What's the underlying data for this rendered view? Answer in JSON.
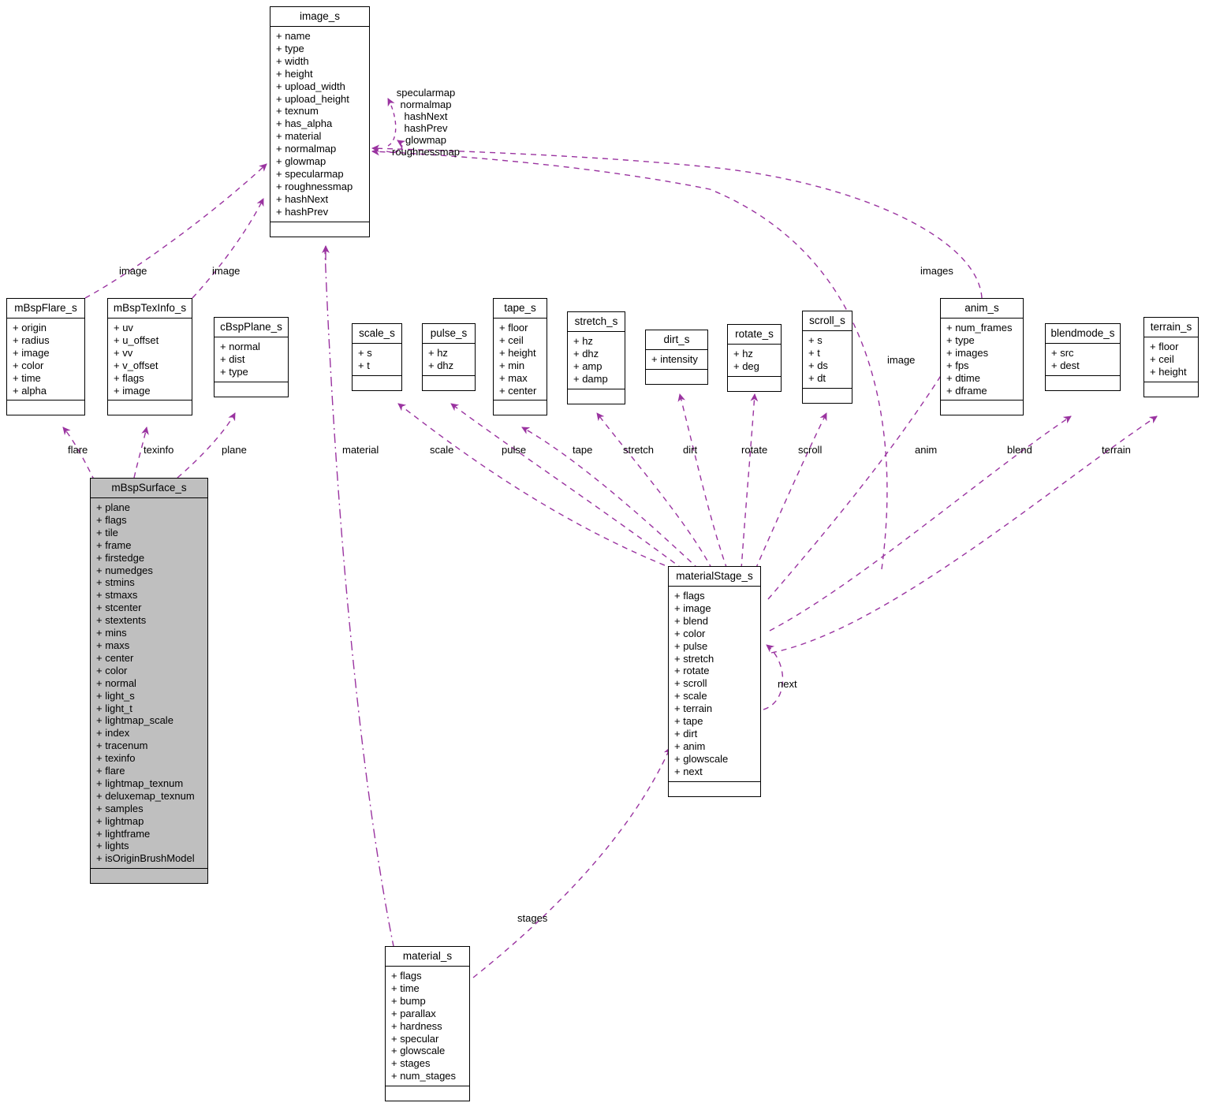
{
  "diagram": {
    "type": "uml-collaboration-diagram",
    "edge_color": "#9a33a0",
    "highlight_fill": "#bfbfbf",
    "border_color": "#000000"
  },
  "nodes": {
    "image_s": {
      "title": "image_s",
      "fields": [
        "+ name",
        "+ type",
        "+ width",
        "+ height",
        "+ upload_width",
        "+ upload_height",
        "+ texnum",
        "+ has_alpha",
        "+ material",
        "+ normalmap",
        "+ glowmap",
        "+ specularmap",
        "+ roughnessmap",
        "+ hashNext",
        "+ hashPrev"
      ],
      "methods": []
    },
    "mBspFlare_s": {
      "title": "mBspFlare_s",
      "fields": [
        "+ origin",
        "+ radius",
        "+ image",
        "+ color",
        "+ time",
        "+ alpha"
      ],
      "methods": []
    },
    "mBspTexInfo_s": {
      "title": "mBspTexInfo_s",
      "fields": [
        "+ uv",
        "+ u_offset",
        "+ vv",
        "+ v_offset",
        "+ flags",
        "+ image"
      ],
      "methods": []
    },
    "cBspPlane_s": {
      "title": "cBspPlane_s",
      "fields": [
        "+ normal",
        "+ dist",
        "+ type"
      ],
      "methods": []
    },
    "scale_s": {
      "title": "scale_s",
      "fields": [
        "+ s",
        "+ t"
      ],
      "methods": []
    },
    "pulse_s": {
      "title": "pulse_s",
      "fields": [
        "+ hz",
        "+ dhz"
      ],
      "methods": []
    },
    "tape_s": {
      "title": "tape_s",
      "fields": [
        "+ floor",
        "+ ceil",
        "+ height",
        "+ min",
        "+ max",
        "+ center"
      ],
      "methods": []
    },
    "stretch_s": {
      "title": "stretch_s",
      "fields": [
        "+ hz",
        "+ dhz",
        "+ amp",
        "+ damp"
      ],
      "methods": []
    },
    "dirt_s": {
      "title": "dirt_s",
      "fields": [
        "+ intensity"
      ],
      "methods": []
    },
    "rotate_s": {
      "title": "rotate_s",
      "fields": [
        "+ hz",
        "+ deg"
      ],
      "methods": []
    },
    "scroll_s": {
      "title": "scroll_s",
      "fields": [
        "+ s",
        "+ t",
        "+ ds",
        "+ dt"
      ],
      "methods": []
    },
    "anim_s": {
      "title": "anim_s",
      "fields": [
        "+ num_frames",
        "+ type",
        "+ images",
        "+ fps",
        "+ dtime",
        "+ dframe"
      ],
      "methods": []
    },
    "blendmode_s": {
      "title": "blendmode_s",
      "fields": [
        "+ src",
        "+ dest"
      ],
      "methods": []
    },
    "terrain_s": {
      "title": "terrain_s",
      "fields": [
        "+ floor",
        "+ ceil",
        "+ height"
      ],
      "methods": []
    },
    "mBspSurface_s": {
      "title": "mBspSurface_s",
      "fields": [
        "+ plane",
        "+ flags",
        "+ tile",
        "+ frame",
        "+ firstedge",
        "+ numedges",
        "+ stmins",
        "+ stmaxs",
        "+ stcenter",
        "+ stextents",
        "+ mins",
        "+ maxs",
        "+ center",
        "+ color",
        "+ normal",
        "+ light_s",
        "+ light_t",
        "+ lightmap_scale",
        "+ index",
        "+ tracenum",
        "+ texinfo",
        "+ flare",
        "+ lightmap_texnum",
        "+ deluxemap_texnum",
        "+ samples",
        "+ lightmap",
        "+ lightframe",
        "+ lights",
        "+ isOriginBrushModel"
      ],
      "methods": []
    },
    "materialStage_s": {
      "title": "materialStage_s",
      "fields": [
        "+ flags",
        "+ image",
        "+ blend",
        "+ color",
        "+ pulse",
        "+ stretch",
        "+ rotate",
        "+ scroll",
        "+ scale",
        "+ terrain",
        "+ tape",
        "+ dirt",
        "+ anim",
        "+ glowscale",
        "+ next"
      ],
      "methods": []
    },
    "material_s": {
      "title": "material_s",
      "fields": [
        "+ flags",
        "+ time",
        "+ bump",
        "+ parallax",
        "+ hardness",
        "+ specular",
        "+ glowscale",
        "+ stages",
        "+ num_stages"
      ],
      "methods": []
    }
  },
  "edge_labels": {
    "image_self_loop": "specularmap\nnormalmap\nhashNext\nhashPrev\nglowmap\nroughnessmap",
    "flare_image": "image",
    "texinfo_image": "image",
    "flare": "flare",
    "texinfo": "texinfo",
    "plane": "plane",
    "material": "material",
    "scale": "scale",
    "pulse": "pulse",
    "tape": "tape",
    "stretch": "stretch",
    "dirt": "dirt",
    "rotate": "rotate",
    "scroll": "scroll",
    "anim": "anim",
    "blend": "blend",
    "terrain": "terrain",
    "stage_image": "image",
    "images": "images",
    "next": "next",
    "stages": "stages"
  }
}
